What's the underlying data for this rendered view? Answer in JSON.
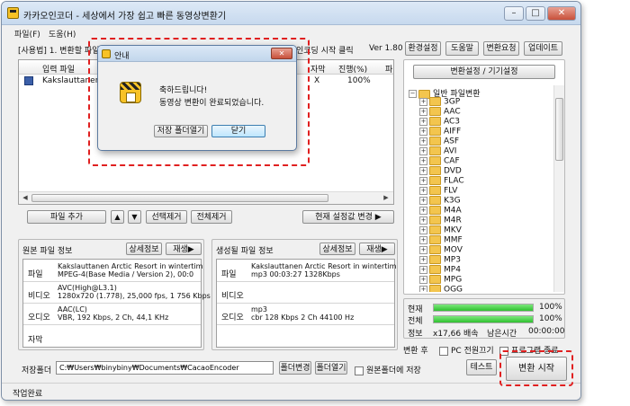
{
  "app": {
    "title": "카카오인코더 - 세상에서 가장 쉽고 빠른 동영상변환기",
    "menu": [
      "파일(F)",
      "도움(H)"
    ]
  },
  "header": {
    "status_text": "[사용법] 1. 변환할 파일",
    "encode_label": "인코딩 시작 클릭",
    "version": "Ver 1.80",
    "buttons": [
      "환경설정",
      "도움말",
      "변환요청",
      "업데이트"
    ]
  },
  "filelist": {
    "columns": [
      "입력 파일",
      "자막",
      "진행(%)",
      "파"
    ],
    "rows": [
      {
        "name": "Kakslauttanen A",
        "subtitle": "X",
        "progress": "100%"
      }
    ]
  },
  "file_controls": {
    "add": "파일 추가",
    "up": "▲",
    "down": "▼",
    "remove_selected": "선택제거",
    "remove_all": "전체제거",
    "change_settings": "현재 설정값 변경 ▶"
  },
  "original_info": {
    "title": "원본 파일 정보",
    "detail_btn": "상세정보",
    "play_btn": "재생▶",
    "rows": [
      {
        "label": "파일",
        "value1": "Kakslauttanen Arctic Resort in wintertim",
        "value2": "MPEG-4(Base Media / Version 2), 00:0"
      },
      {
        "label": "비디오",
        "value1": "AVC(High@L3.1)",
        "value2": "1280x720 (1.778), 25,000 fps, 1 756 Kbps"
      },
      {
        "label": "오디오",
        "value1": "AAC(LC)",
        "value2": "VBR, 192 Kbps, 2 Ch, 44,1 KHz"
      },
      {
        "label": "자막",
        "value1": "",
        "value2": ""
      }
    ]
  },
  "generated_info": {
    "title": "생성될 파일 정보",
    "detail_btn": "상세정보",
    "play_btn": "재생▶",
    "rows": [
      {
        "label": "파일",
        "value1": "Kakslauttanen Arctic Resort in wintertim",
        "value2": "mp3   00:03:27   1328Kbps"
      },
      {
        "label": "비디오",
        "value1": "",
        "value2": ""
      },
      {
        "label": "오디오",
        "value1": "mp3",
        "value2": "cbr      128 Kbps   2 Ch   44100 Hz"
      }
    ]
  },
  "save": {
    "label": "저장폴더",
    "path": "C:₩Users₩binybiny₩Documents₩CacaoEncoder",
    "change_btn": "폴더변경",
    "open_btn": "폴더열기",
    "same_folder": "원본폴더에 저장"
  },
  "right": {
    "settings_btn": "변환설정 / 기기설정",
    "tree_root": "일반 파일변환",
    "tree_items": [
      "3GP",
      "AAC",
      "AC3",
      "AIFF",
      "ASF",
      "AVI",
      "CAF",
      "DVD",
      "FLAC",
      "FLV",
      "K3G",
      "M4A",
      "M4R",
      "MKV",
      "MMF",
      "MOV",
      "MP3",
      "MP4",
      "MPG",
      "OGG"
    ],
    "progress": {
      "current_label": "현재",
      "current_value": "100%",
      "current_fraction": 1.0,
      "total_label": "전체",
      "total_value": "100%",
      "total_fraction": 1.0,
      "info_label": "정보",
      "speed": "x17,66 배속",
      "remaining_label": "남은시간",
      "remaining_value": "00:00:00"
    },
    "after_label": "변환 후",
    "pc_off": "PC 전원끄기",
    "exit_program": "프로그램 종료",
    "test_btn": "테스트",
    "start_btn": "변환 시작"
  },
  "statusbar": "작업완료",
  "dialog": {
    "title": "안내",
    "line1": "축하드립니다!",
    "line2": "동영상 변환이 완료되었습니다.",
    "open_folder_btn": "저장 폴더열기",
    "close_btn": "닫기"
  },
  "colors": {
    "progress_green": "#2fc12f",
    "highlight": "#e02020"
  }
}
